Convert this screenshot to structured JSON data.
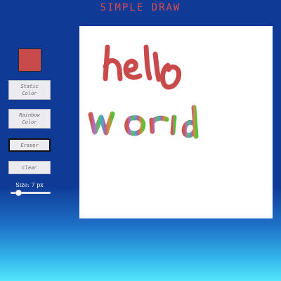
{
  "app": {
    "title": "SIMPLE DRAW"
  },
  "toolbar": {
    "current_color": "#c94a4a",
    "static_color_button": {
      "line1": "Static",
      "line2": "Color"
    },
    "rainbow_color_button": {
      "line1": "Rainbow",
      "line2": "Color"
    },
    "eraser_button": "Eraser",
    "clear_button": "Clear",
    "active_tool": "Eraser",
    "brush_size": {
      "label": "Size: 7 px",
      "value": 7,
      "min": 1,
      "max": 50
    }
  },
  "canvas": {
    "background": "#ffffff",
    "drawings": {
      "hello": {
        "text": "hello",
        "color": "#c94a4a"
      },
      "world": {
        "text": "world",
        "stroke": "rainbow",
        "colors": [
          "#c9584a",
          "#b070d2",
          "#59bf4a",
          "#4aa3d9",
          "#b8618c",
          "#d98a3a",
          "#58bf3a"
        ]
      }
    }
  }
}
